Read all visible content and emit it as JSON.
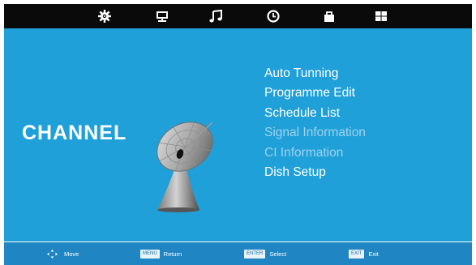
{
  "tabs": [
    {
      "icon": "gear-icon",
      "active": true
    },
    {
      "icon": "monitor-icon",
      "active": false
    },
    {
      "icon": "music-note-icon",
      "active": false
    },
    {
      "icon": "clock-icon",
      "active": false
    },
    {
      "icon": "lock-icon",
      "active": false
    },
    {
      "icon": "grid-icon",
      "active": false
    }
  ],
  "page_title": "CHANNEL",
  "menu": [
    {
      "label": "Auto Tunning",
      "enabled": true
    },
    {
      "label": "Programme Edit",
      "enabled": true
    },
    {
      "label": "Schedule List",
      "enabled": true
    },
    {
      "label": "Signal Information",
      "enabled": false
    },
    {
      "label": "CI Information",
      "enabled": false
    },
    {
      "label": "Dish Setup",
      "enabled": true
    }
  ],
  "footer": {
    "move_label": "Move",
    "menu_key": "MENU",
    "return_label": "Return",
    "enter_key": "ENTER",
    "select_label": "Select",
    "exit_key": "EXIT",
    "exit_label": "Exit"
  },
  "colors": {
    "panel": "#1fa0d8",
    "topbar": "#0a0a0a",
    "footer": "#1f86c3",
    "disabled_text": "#9fd2ec"
  }
}
